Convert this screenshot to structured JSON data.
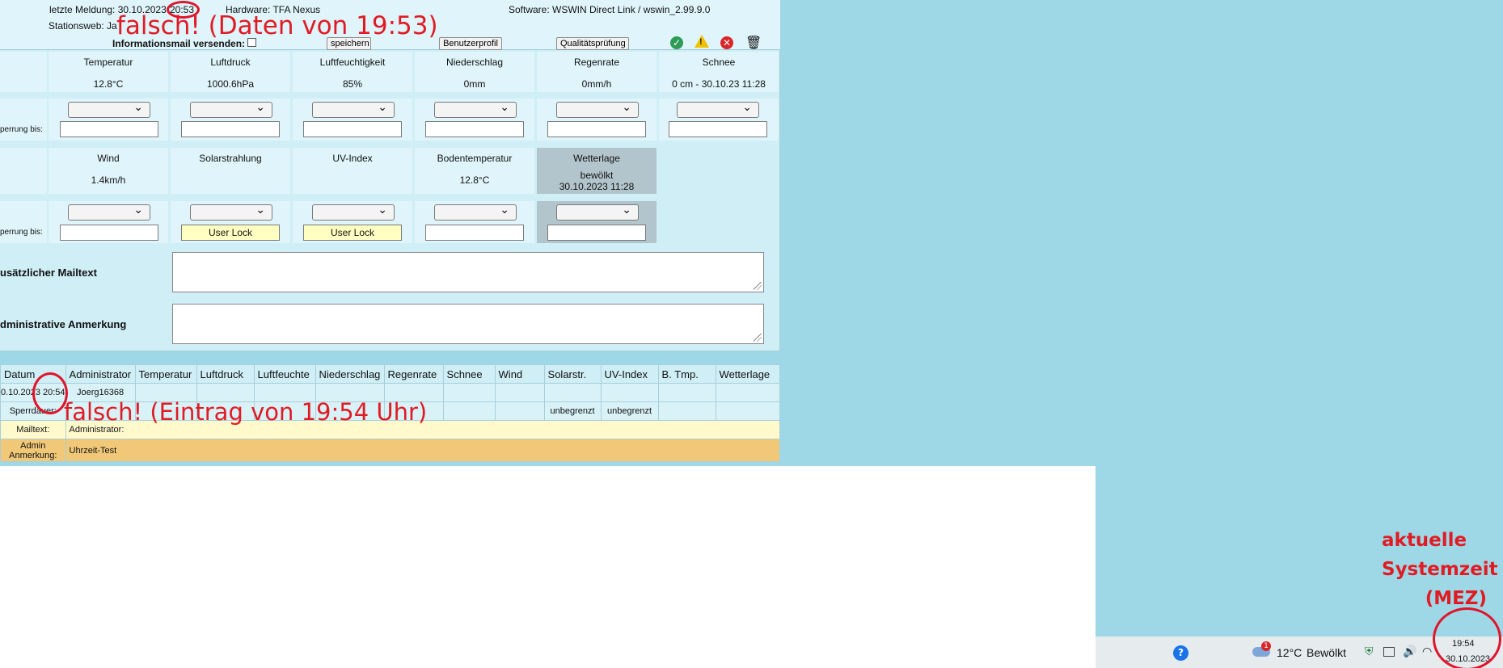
{
  "header": {
    "last_report_label": "letzte Meldung: 30.10.2023",
    "last_report_time": "20:53",
    "hardware": "Hardware: TFA Nexus",
    "software": "Software: WSWIN Direct Link / wswin_2.99.9.0",
    "stationsweb": "Stationsweb: Ja",
    "infomail_label": "Informationsmail versenden:",
    "save_btn": "speichern",
    "profile_btn": "Benutzerprofil",
    "quality_btn": "Qualitätsprüfung"
  },
  "row1": [
    {
      "label": "Temperatur",
      "value": "12.8°C"
    },
    {
      "label": "Luftdruck",
      "value": "1000.6hPa"
    },
    {
      "label": "Luftfeuchtigkeit",
      "value": "85%"
    },
    {
      "label": "Niederschlag",
      "value": "0mm"
    },
    {
      "label": "Regenrate",
      "value": "0mm/h"
    },
    {
      "label": "Schnee",
      "value": "0 cm - 30.10.23 11:28"
    }
  ],
  "row2": [
    {
      "label": "Wind",
      "value": "1.4km/h"
    },
    {
      "label": "Solarstrahlung",
      "value": ""
    },
    {
      "label": "UV-Index",
      "value": ""
    },
    {
      "label": "Bodentemperatur",
      "value": "12.8°C"
    },
    {
      "label": "Wetterlage",
      "value": "bewölkt",
      "value2": "30.10.2023 11:28"
    }
  ],
  "sperrung_label": "perrung bis:",
  "lock_text": "User Lock",
  "mailtext_label": "usätzlicher Mailtext",
  "admin_note_label": "dministrative Anmerkung",
  "log": {
    "headers": [
      "Datum",
      "Administrator",
      "Temperatur",
      "Luftdruck",
      "Luftfeuchte",
      "Niederschlag",
      "Regenrate",
      "Schnee",
      "Wind",
      "Solarstr.",
      "UV-Index",
      "B. Tmp.",
      "Wetterlage"
    ],
    "entry_date": "0.10.2023",
    "entry_time": "20:54",
    "entry_admin": "Joerg16368",
    "sperrdauer_label": "Sperrdauer:",
    "unlimited": "unbegrenzt",
    "mailtext_label": "Mailtext:",
    "mailtext_value": "Administrator:",
    "admin_label_1": "Admin",
    "admin_label_2": "Anmerkung:",
    "admin_value": "Uhrzeit-Test"
  },
  "annotations": {
    "top": "falsch! (Daten von 19:53)",
    "middle": "falsch! (Eintrag von 19:54 Uhr)",
    "right_1": "aktuelle",
    "right_2": "Systemzeit",
    "right_3": "(MEZ)"
  },
  "taskbar": {
    "weather_temp": "12°C",
    "weather_text": "Bewölkt",
    "weather_badge": "1",
    "clock_time": "19:54",
    "clock_date": "30.10.2023"
  },
  "colors": {
    "annotation_red": "#e01b24",
    "desktop": "#9ed8e6",
    "lock_yellow": "#ffffc2"
  }
}
